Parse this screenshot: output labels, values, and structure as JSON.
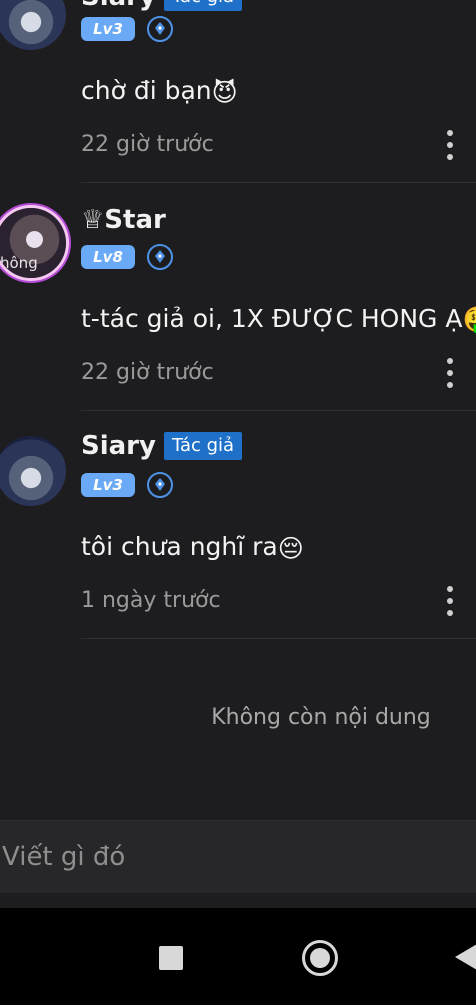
{
  "comments": [
    {
      "author": "Siary",
      "author_badge": "Tác giả",
      "level": "Lv3",
      "text": "chờ đi bạn",
      "emoji": "😈",
      "time": "22 giờ trước"
    },
    {
      "author": "♕Star",
      "level": "Lv8",
      "avatar_text": "hông",
      "text": "t-tác giả oi, 1X ĐƯỢC HONG Ạ",
      "emoji": "🤑",
      "time": "22 giờ trước"
    },
    {
      "author": "Siary",
      "author_badge": "Tác giả",
      "level": "Lv3",
      "text": "tôi chưa nghĩ ra",
      "emoji": "😔",
      "time": "1 ngày trước"
    }
  ],
  "end_of_list": "Không còn nội dung",
  "composer": {
    "placeholder": "Viết gì đó"
  },
  "colors": {
    "badge_blue": "#1f70c9",
    "level_blue": "#69a9f5",
    "background": "#1d1d1f"
  },
  "icons": [
    "more-vertical-icon",
    "pen-icon",
    "nav-recent-apps-icon",
    "nav-home-icon",
    "nav-back-icon"
  ]
}
